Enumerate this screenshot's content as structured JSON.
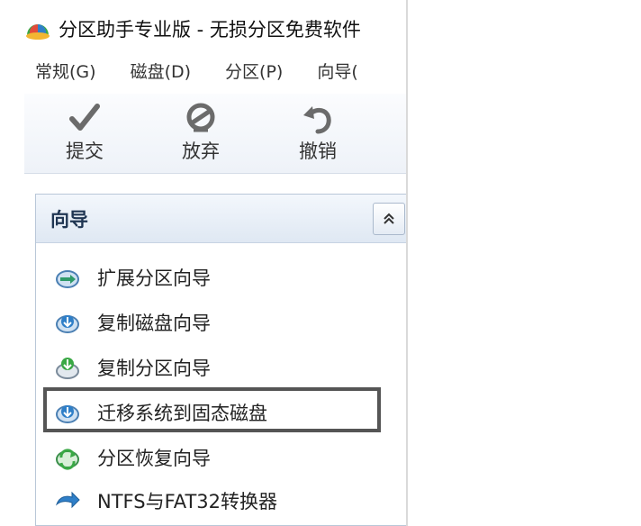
{
  "window": {
    "title": "分区助手专业版 - 无损分区免费软件"
  },
  "menu": [
    "常规(G)",
    "磁盘(D)",
    "分区(P)",
    "向导("
  ],
  "toolbar": {
    "commit_label": "提交",
    "discard_label": "放弃",
    "undo_label": "撤销"
  },
  "panel": {
    "title": "向导",
    "items": [
      {
        "label": "扩展分区向导",
        "icon": "extend-partition-icon"
      },
      {
        "label": "复制磁盘向导",
        "icon": "copy-disk-icon"
      },
      {
        "label": "复制分区向导",
        "icon": "copy-partition-icon"
      },
      {
        "label": "迁移系统到固态磁盘",
        "icon": "migrate-os-ssd-icon",
        "highlighted": true
      },
      {
        "label": "分区恢复向导",
        "icon": "partition-recovery-icon"
      },
      {
        "label": "NTFS与FAT32转换器",
        "icon": "ntfs-fat32-converter-icon"
      }
    ]
  },
  "colors": {
    "accent_blue": "#2f7fc8",
    "accent_green": "#3aa845",
    "highlight_border": "#555555"
  }
}
